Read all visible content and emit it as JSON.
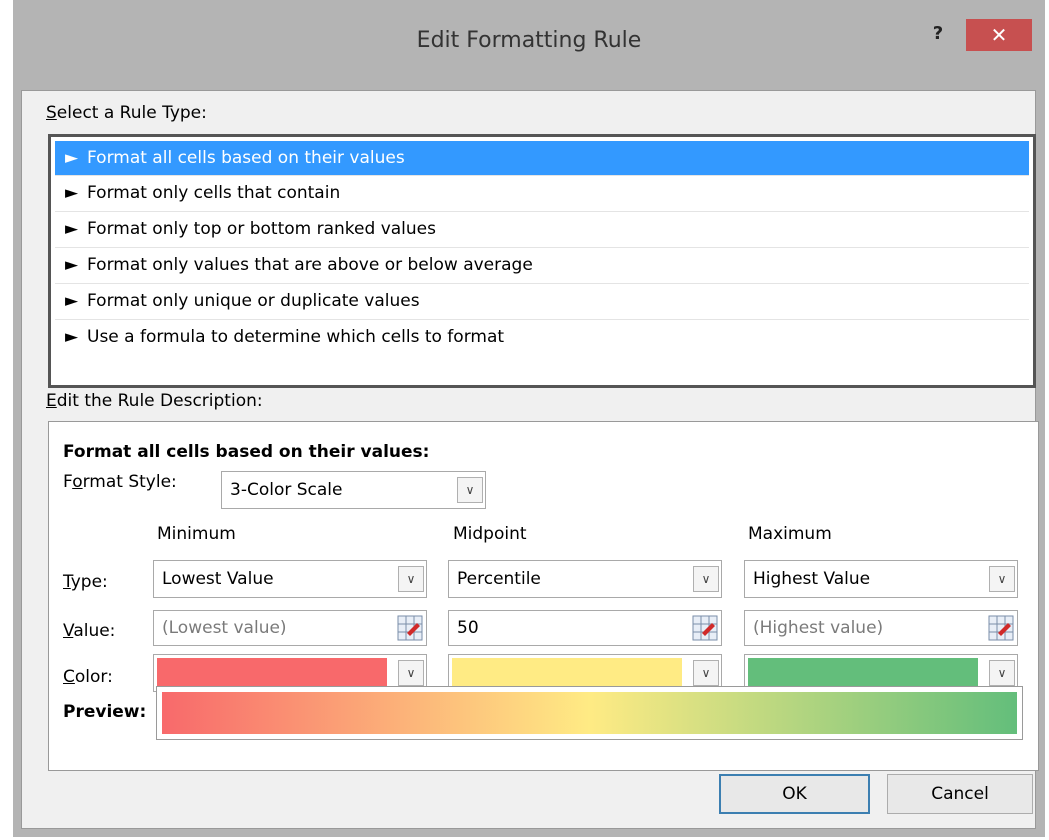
{
  "window": {
    "title": "Edit Formatting Rule",
    "help_label": "?",
    "close_label": "✕"
  },
  "rule_type": {
    "label_prefix": "S",
    "label_rest": "elect a Rule Type:",
    "arrow": "►",
    "items": [
      {
        "label": "Format all cells based on their values",
        "selected": true
      },
      {
        "label": "Format only cells that contain",
        "selected": false
      },
      {
        "label": "Format only top or bottom ranked values",
        "selected": false
      },
      {
        "label": "Format only values that are above or below average",
        "selected": false
      },
      {
        "label": "Format only unique or duplicate values",
        "selected": false
      },
      {
        "label": "Use a formula to determine which cells to format",
        "selected": false
      }
    ]
  },
  "description": {
    "label_prefix": "E",
    "label_rest": "dit the Rule Description:",
    "heading": "Format all cells based on their values:",
    "format_style_label_a": "F",
    "format_style_label_b": "o",
    "format_style_label_c": "rmat Style:",
    "format_style_value": "3-Color Scale",
    "row_labels": {
      "type_prefix": "T",
      "type_rest": "ype:",
      "value_prefix": "V",
      "value_rest": "alue:",
      "color_prefix": "C",
      "color_rest": "olor:"
    },
    "columns": [
      {
        "header": "Minimum",
        "type": "Lowest Value",
        "value": "(Lowest value)",
        "value_placeholder": true,
        "color": "#f8696b"
      },
      {
        "header": "Midpoint",
        "type": "Percentile",
        "value": "50",
        "value_placeholder": false,
        "color": "#ffeb84"
      },
      {
        "header": "Maximum",
        "type": "Highest Value",
        "value": "(Highest value)",
        "value_placeholder": true,
        "color": "#63be7b"
      }
    ],
    "preview_label": "Preview:"
  },
  "buttons": {
    "ok": "OK",
    "cancel": "Cancel"
  },
  "colors": {
    "selection": "#3399ff",
    "close_button": "#c75050",
    "chrome": "#b4b4b4"
  }
}
